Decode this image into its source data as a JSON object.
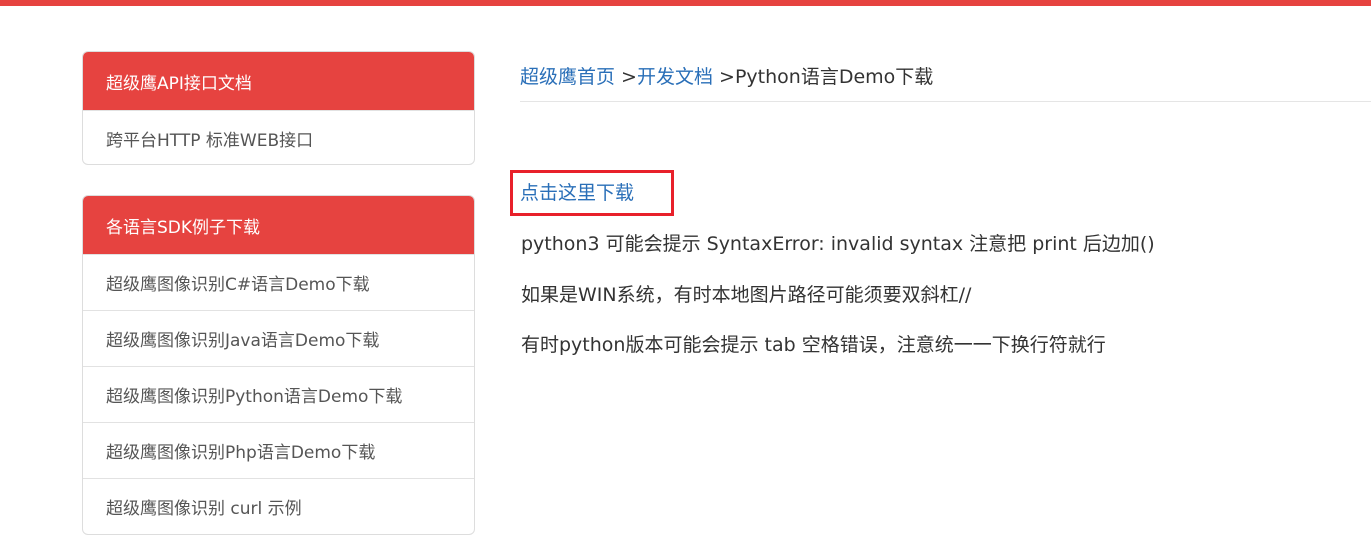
{
  "accent_color": "#e64340",
  "link_color": "#2a6fb8",
  "highlight_color": "#e8202a",
  "sidebar": {
    "api_panel": {
      "title": "超级鹰API接口文档",
      "items": [
        {
          "label": "跨平台HTTP 标准WEB接口"
        }
      ]
    },
    "sdk_panel": {
      "title": "各语言SDK例子下载",
      "items": [
        {
          "label": "超级鹰图像识别C#语言Demo下载"
        },
        {
          "label": "超级鹰图像识别Java语言Demo下载"
        },
        {
          "label": "超级鹰图像识别Python语言Demo下载"
        },
        {
          "label": "超级鹰图像识别Php语言Demo下载"
        },
        {
          "label": "超级鹰图像识别 curl 示例"
        }
      ]
    }
  },
  "breadcrumb": {
    "home": "超级鹰首页",
    "sep1": " >",
    "docs": "开发文档",
    "sep2": " >",
    "current": "Python语言Demo下载"
  },
  "main": {
    "download_link": "点击这里下载",
    "notes": [
      "python3 可能会提示 SyntaxError: invalid syntax  注意把 print 后边加()",
      "如果是WIN系统，有时本地图片路径可能须要双斜杠//",
      "有时python版本可能会提示 tab 空格错误，注意统一一下换行符就行"
    ]
  }
}
